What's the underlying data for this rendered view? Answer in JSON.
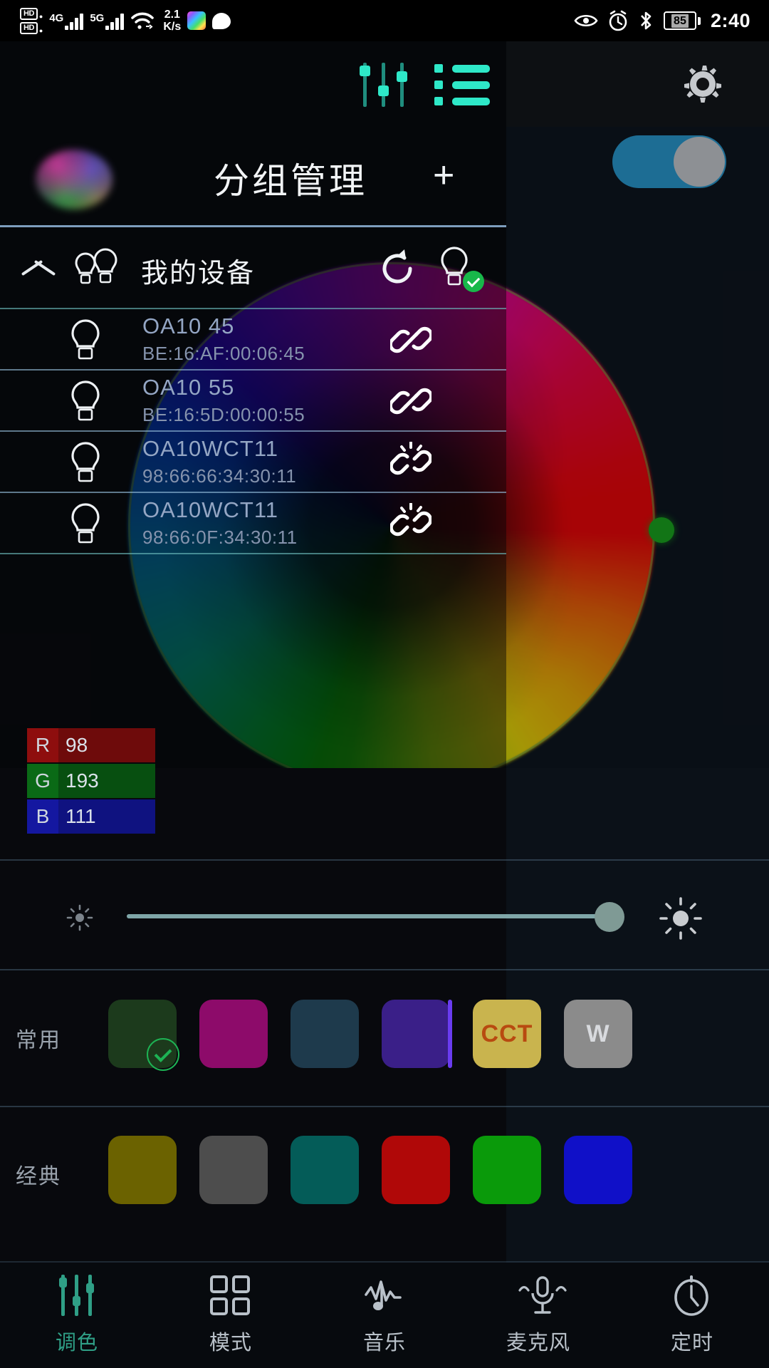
{
  "status_bar": {
    "hd_badges": [
      "HD",
      "HD"
    ],
    "network_1": "4G",
    "network_2": "5G",
    "wifi": "wifi-icon",
    "net_speed_value": "2.1",
    "net_speed_unit": "K/s",
    "app_icons": [
      "rainbow-app-icon",
      "chat-bubble-icon"
    ],
    "right_icons": [
      "eye-icon",
      "alarm-icon",
      "bluetooth-icon"
    ],
    "battery_level": "85",
    "time": "2:40"
  },
  "toolbar": {
    "sliders_icon": "sliders-icon",
    "list_icon": "list-icon",
    "settings_icon": "gear-icon"
  },
  "group_header": {
    "orb": "color-orb",
    "title": "分组管理",
    "add_label": "+",
    "power_toggle_state": "on"
  },
  "devices_section": {
    "collapse_icon": "chevron-up-icon",
    "group_icon": "double-bulb-icon",
    "label": "我的设备",
    "refresh_icon": "refresh-icon",
    "bulb_check_icon": "bulb-check-icon",
    "rows": [
      {
        "name": "OA10   45",
        "mac": "BE:16:AF:00:06:45",
        "bulb_icon": "bulb-icon",
        "link_icon": "link-connected-icon",
        "connected": true
      },
      {
        "name": "OA10   55",
        "mac": "BE:16:5D:00:00:55",
        "bulb_icon": "bulb-icon",
        "link_icon": "link-connected-icon",
        "connected": true
      },
      {
        "name": "OA10WCT11",
        "mac": "98:66:66:34:30:11",
        "bulb_icon": "bulb-icon",
        "link_icon": "link-broken-icon",
        "connected": false
      },
      {
        "name": "OA10WCT11",
        "mac": "98:66:0F:34:30:11",
        "bulb_icon": "bulb-icon",
        "link_icon": "link-broken-icon",
        "connected": false
      }
    ]
  },
  "color_picker": {
    "wheel_icon": "color-wheel",
    "handle_color": "#17a317",
    "rgb": {
      "r_key": "R",
      "r_value": "98",
      "g_key": "G",
      "g_value": "193",
      "b_key": "B",
      "b_value": "111"
    }
  },
  "brightness": {
    "low_icon": "brightness-low-icon",
    "high_icon": "brightness-high-icon",
    "value_percent": 98
  },
  "favorites": {
    "label": "常用",
    "swatches": [
      {
        "color": "#1c3a1c",
        "text": "",
        "selected": true,
        "name": "swatch-green-dark"
      },
      {
        "color": "#8d0b6a",
        "text": "",
        "selected": false,
        "name": "swatch-magenta"
      },
      {
        "color": "#1e3a4c",
        "text": "",
        "selected": false,
        "name": "swatch-steel-blue"
      },
      {
        "color": "#3a1f88",
        "text": "",
        "selected": false,
        "name": "swatch-violet"
      },
      {
        "color": "#c9b44e",
        "text": "CCT",
        "text_color": "#b84a10",
        "selected": false,
        "name": "swatch-cct"
      },
      {
        "color": "#8b8b8b",
        "text": "W",
        "text_color": "#d8dade",
        "selected": false,
        "name": "swatch-white"
      }
    ]
  },
  "classic": {
    "label": "经典",
    "swatches": [
      {
        "color": "#6b6200",
        "name": "swatch-olive"
      },
      {
        "color": "#4d4d4d",
        "name": "swatch-gray"
      },
      {
        "color": "#045c58",
        "name": "swatch-teal"
      },
      {
        "color": "#b00808",
        "name": "swatch-red"
      },
      {
        "color": "#0a9a0a",
        "name": "swatch-green"
      },
      {
        "color": "#1010c8",
        "name": "swatch-blue"
      }
    ]
  },
  "bottom_nav": {
    "items": [
      {
        "label": "调色",
        "icon": "sliders-icon",
        "active": true
      },
      {
        "label": "模式",
        "icon": "grid-icon",
        "active": false
      },
      {
        "label": "音乐",
        "icon": "music-icon",
        "active": false
      },
      {
        "label": "麦克风",
        "icon": "mic-icon",
        "active": false
      },
      {
        "label": "定时",
        "icon": "timer-icon",
        "active": false
      }
    ]
  }
}
